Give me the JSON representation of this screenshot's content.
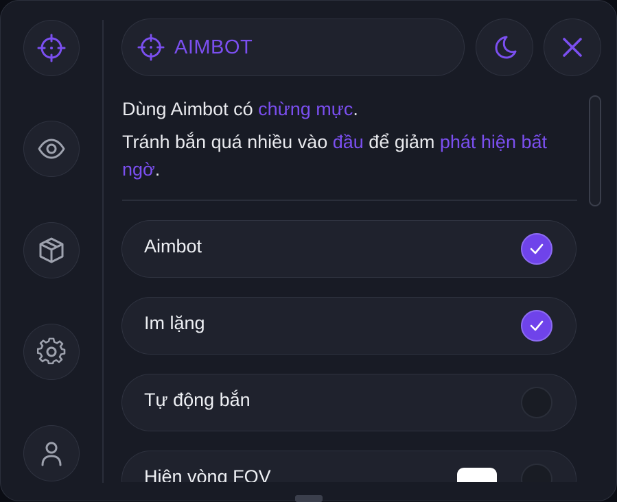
{
  "header": {
    "title": "AIMBOT",
    "icons": {
      "title": "crosshair-icon",
      "theme_toggle": "moon-icon",
      "close": "close-icon"
    }
  },
  "sidebar": {
    "items": [
      {
        "icon": "crosshair-icon",
        "active": true
      },
      {
        "icon": "eye-icon",
        "active": false
      },
      {
        "icon": "cube-icon",
        "active": false
      },
      {
        "icon": "gear-icon",
        "active": false
      },
      {
        "icon": "user-icon",
        "active": false
      }
    ]
  },
  "description": {
    "line1_a": "Dùng Aimbot có ",
    "line1_hl": "chừng mực",
    "line1_b": ".",
    "line2_a": "Tránh bắn quá nhiều vào ",
    "line2_hl1": "đầu",
    "line2_b": " để giảm ",
    "line2_hl2": "phát hiện bất ngờ",
    "line2_c": "."
  },
  "options": [
    {
      "label": "Aimbot",
      "checked": true
    },
    {
      "label": "Im lặng",
      "checked": true
    },
    {
      "label": "Tự động bắn",
      "checked": false
    },
    {
      "label": "Hiện vòng FOV",
      "checked": false
    }
  ],
  "colors": {
    "accent": "#7b4ff0",
    "panel": "#181b25",
    "pill": "#1f222d",
    "text": "#e9eaee"
  }
}
